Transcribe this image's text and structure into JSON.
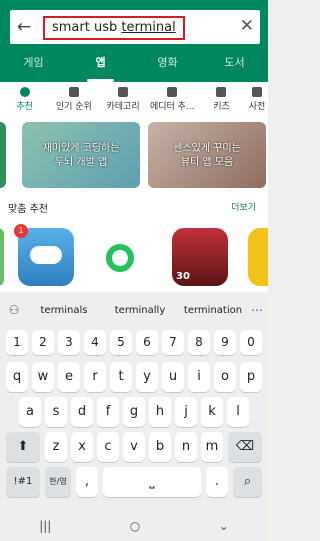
{
  "search": {
    "query_plain": "smart usb ",
    "query_underlined": "terminal"
  },
  "tabs": [
    "게임",
    "앱",
    "영화",
    "도서"
  ],
  "categories": [
    "추천",
    "인기 순위",
    "카테고리",
    "에디터 추...",
    "키즈",
    "사전"
  ],
  "banners": [
    {
      "text": "재미있게 코딩하는\n두뇌 개발 앱"
    },
    {
      "text": "센스있게 꾸미는\n뷰티 앱 모음"
    }
  ],
  "recommend": {
    "title": "맞춤 추천",
    "more": "더보기",
    "badge": "1",
    "fitness_badge": "30"
  },
  "keyboard": {
    "suggestions": [
      "terminals",
      "terminally",
      "termination"
    ],
    "numbers": [
      "1",
      "2",
      "3",
      "4",
      "5",
      "6",
      "7",
      "8",
      "9",
      "0"
    ],
    "row1": [
      "q",
      "w",
      "e",
      "r",
      "t",
      "y",
      "u",
      "i",
      "o",
      "p"
    ],
    "row2": [
      "a",
      "s",
      "d",
      "f",
      "g",
      "h",
      "j",
      "k",
      "l"
    ],
    "row3": [
      "z",
      "x",
      "c",
      "v",
      "b",
      "n",
      "m"
    ],
    "sym": "!#1",
    "lang": "한/영",
    "comma": ",",
    "period": "."
  },
  "colors": {
    "brand": "#01875f",
    "highlight": "#d81b22"
  }
}
